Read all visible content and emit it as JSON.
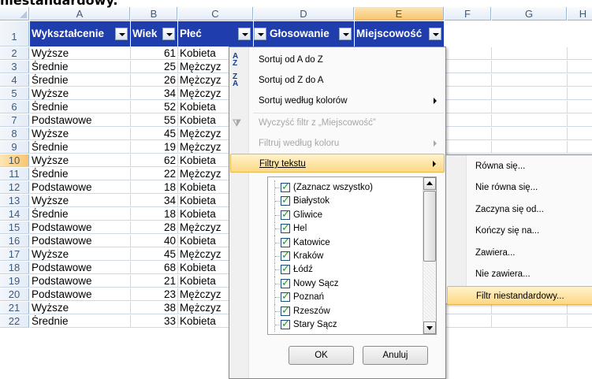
{
  "heading": "niestandardowy.",
  "columns": [
    "A",
    "B",
    "C",
    "D",
    "E",
    "F",
    "G",
    "H"
  ],
  "header_row": {
    "row": "1",
    "cells": [
      "Wykształcenie",
      "Wiek",
      "Płeć",
      "Głosowanie",
      "Miejscowość"
    ]
  },
  "rows": [
    {
      "n": "2",
      "edu": "Wyższe",
      "age": "61",
      "sex": "Kobieta"
    },
    {
      "n": "3",
      "edu": "Średnie",
      "age": "25",
      "sex": "Mężczyz"
    },
    {
      "n": "4",
      "edu": "Średnie",
      "age": "26",
      "sex": "Mężczyz"
    },
    {
      "n": "5",
      "edu": "Wyższe",
      "age": "34",
      "sex": "Mężczyz"
    },
    {
      "n": "6",
      "edu": "Średnie",
      "age": "52",
      "sex": "Kobieta"
    },
    {
      "n": "7",
      "edu": "Podstawowe",
      "age": "55",
      "sex": "Kobieta"
    },
    {
      "n": "8",
      "edu": "Wyższe",
      "age": "45",
      "sex": "Mężczyz"
    },
    {
      "n": "9",
      "edu": "Średnie",
      "age": "19",
      "sex": "Mężczyz"
    },
    {
      "n": "10",
      "edu": "Wyższe",
      "age": "62",
      "sex": "Kobieta"
    },
    {
      "n": "11",
      "edu": "Średnie",
      "age": "22",
      "sex": "Mężczyz"
    },
    {
      "n": "12",
      "edu": "Podstawowe",
      "age": "18",
      "sex": "Kobieta"
    },
    {
      "n": "13",
      "edu": "Wyższe",
      "age": "34",
      "sex": "Kobieta"
    },
    {
      "n": "14",
      "edu": "Średnie",
      "age": "18",
      "sex": "Kobieta"
    },
    {
      "n": "15",
      "edu": "Podstawowe",
      "age": "28",
      "sex": "Mężczyz"
    },
    {
      "n": "16",
      "edu": "Podstawowe",
      "age": "40",
      "sex": "Kobieta"
    },
    {
      "n": "17",
      "edu": "Wyższe",
      "age": "45",
      "sex": "Mężczyz"
    },
    {
      "n": "18",
      "edu": "Podstawowe",
      "age": "68",
      "sex": "Kobieta"
    },
    {
      "n": "19",
      "edu": "Podstawowe",
      "age": "21",
      "sex": "Kobieta"
    },
    {
      "n": "20",
      "edu": "Podstawowe",
      "age": "23",
      "sex": "Mężczyz"
    },
    {
      "n": "21",
      "edu": "Wyższe",
      "age": "38",
      "sex": "Mężczyz"
    },
    {
      "n": "22",
      "edu": "Średnie",
      "age": "33",
      "sex": "Kobieta"
    }
  ],
  "menu": {
    "sort_az": "Sortuj od A do Z",
    "sort_za": "Sortuj od Z do A",
    "sort_color": "Sortuj według kolorów",
    "clear_filter": "Wyczyść filtr z „Miejscowość”",
    "filter_color": "Filtruj według koloru",
    "text_filters": "Filtry tekstu",
    "icons": {
      "sort_az": "sort-ascending-icon",
      "sort_za": "sort-descending-icon",
      "clear": "clear-filter-icon"
    }
  },
  "checklist": [
    "(Zaznacz wszystko)",
    "Białystok",
    "Gliwice",
    "Hel",
    "Katowice",
    "Kraków",
    "Łódź",
    "Nowy Sącz",
    "Poznań",
    "Rzeszów",
    "Stary Sącz"
  ],
  "buttons": {
    "ok": "OK",
    "cancel": "Anuluj"
  },
  "submenu": [
    "Równa się...",
    "Nie równa się...",
    "Zaczyna się od...",
    "Kończy się na...",
    "Zawiera...",
    "Nie zawiera...",
    "Filtr niestandardowy..."
  ],
  "colors": {
    "header_bg": "#1f3dad",
    "highlight": "#fcd883"
  }
}
